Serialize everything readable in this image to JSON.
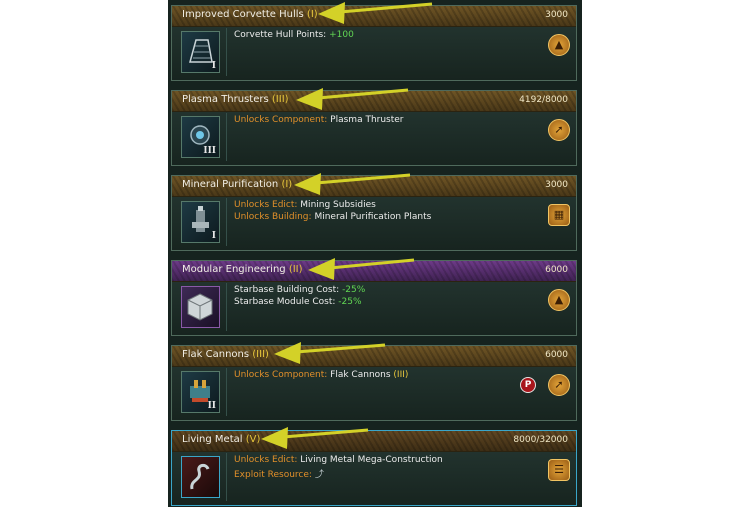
{
  "cards": [
    {
      "name": "Improved Corvette Hulls",
      "tier": "(I)",
      "cost": "3000",
      "roman": "I",
      "icon": "corvette-hull-icon",
      "lines": [
        {
          "label": "Corvette Hull Points:",
          "value": "+100"
        }
      ],
      "area_icon": "engineering-rocket-icon"
    },
    {
      "name": "Plasma Thrusters",
      "tier": "(III)",
      "cost": "4192/8000",
      "roman": "III",
      "icon": "thruster-icon",
      "lines": [
        {
          "label": "Unlocks Component:",
          "value": "Plasma Thruster"
        }
      ],
      "area_icon": "propulsion-icon"
    },
    {
      "name": "Mineral Purification",
      "tier": "(I)",
      "cost": "3000",
      "roman": "I",
      "icon": "mining-station-icon",
      "lines": [
        {
          "label": "Unlocks Edict:",
          "value": "Mining Subsidies"
        },
        {
          "label": "Unlocks Building:",
          "value": "Mineral Purification Plants"
        }
      ],
      "area_icon": "industry-icon"
    },
    {
      "name": "Modular Engineering",
      "tier": "(II)",
      "cost": "6000",
      "roman": "",
      "icon": "modular-cube-icon",
      "lines": [
        {
          "label": "Starbase Building Cost:",
          "value": "-25%"
        },
        {
          "label": "Starbase Module Cost:",
          "value": "-25%"
        }
      ],
      "area_icon": "engineering-rocket-icon"
    },
    {
      "name": "Flak Cannons",
      "tier": "(III)",
      "cost": "6000",
      "roman": "II",
      "icon": "flak-cannon-icon",
      "lines": [
        {
          "label": "Unlocks Component:",
          "value": "Flak Cannons",
          "suffix": "(III)"
        }
      ],
      "badge": "P",
      "area_icon": "propulsion-icon"
    },
    {
      "name": "Living Metal",
      "tier": "(V)",
      "cost": "8000/32000",
      "roman": "",
      "icon": "living-metal-icon",
      "lines": [
        {
          "label": "Unlocks Edict:",
          "value": "Living Metal Mega-Construction"
        },
        {
          "label": "Exploit Resource:",
          "value": ""
        }
      ],
      "area_icon": "materials-icon"
    }
  ],
  "colors": {
    "panel": "#16231f",
    "card_border": "#4f6a5c",
    "label": "#e08f2a",
    "positive": "#61d653",
    "tier": "#e6c63c",
    "arrow": "#d3d128"
  }
}
